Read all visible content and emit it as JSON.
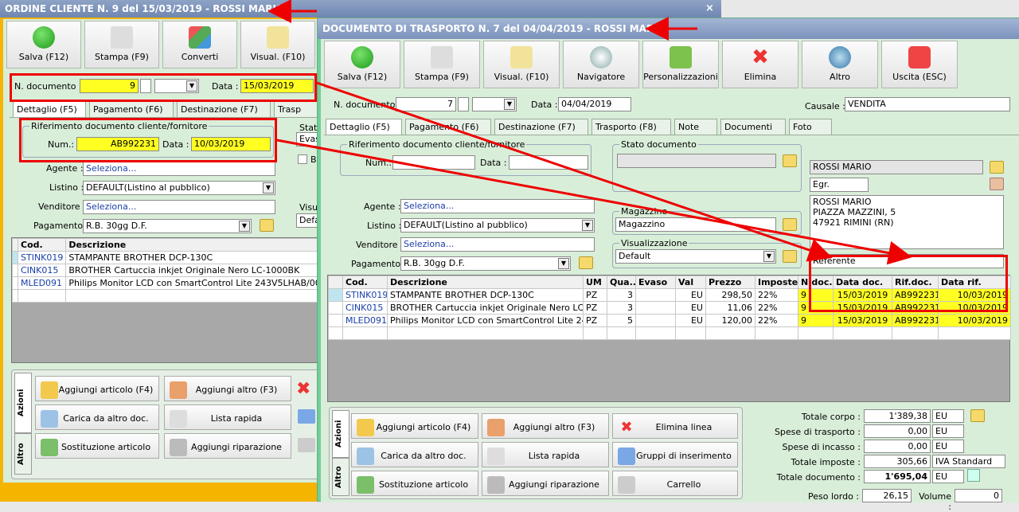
{
  "win1": {
    "title": "ORDINE CLIENTE N. 9 del 15/03/2019 - ROSSI MARIO",
    "close": "×",
    "toolbar": [
      "Salva (F12)",
      "Stampa (F9)",
      "Converti",
      "Visual. (F10)"
    ],
    "ndoc_label": "N. documento :",
    "ndoc_value": "9",
    "data_label": "Data :",
    "data_value": "15/03/2019",
    "tabs": [
      "Dettaglio (F5)",
      "Pagamento (F6)",
      "Destinazione (F7)",
      "Trasp"
    ],
    "rif_group": "Riferimento documento cliente/fornitore",
    "num_label": "Num.:",
    "num_value": "AB992231",
    "rif_data_label": "Data :",
    "rif_data_value": "10/03/2019",
    "stato_label": "Stato",
    "stato_value": "Evas",
    "bo_label": "Bo",
    "visual_label": "Visua",
    "visual_value": "Defa",
    "agente_label": "Agente :",
    "agente_value": "Seleziona...",
    "listino_label": "Listino :",
    "listino_value": "DEFAULT(Listino al pubblico)",
    "venditore_label": "Venditore :",
    "venditore_value": "Seleziona...",
    "pagamento_label": "Pagamento :",
    "pagamento_value": "R.B. 30gg D.F.",
    "grid_headers": [
      "Cod.",
      "Descrizione"
    ],
    "rows": [
      {
        "cod": "STINK019",
        "desc": "STAMPANTE BROTHER DCP-130C"
      },
      {
        "cod": "CINK015",
        "desc": "BROTHER Cartuccia inkjet Originale Nero LC-1000BK"
      },
      {
        "cod": "MLED091",
        "desc": "Philips Monitor LCD con SmartControl Lite 243V5LHAB/00"
      }
    ],
    "vtab_azioni": "Azioni",
    "vtab_altro": "Altro",
    "actions": [
      "Aggiungi articolo (F4)",
      "Aggiungi altro (F3)",
      "Carica da altro doc.",
      "Lista rapida",
      "Sostituzione articolo",
      "Aggiungi riparazione"
    ]
  },
  "win2": {
    "title": "DOCUMENTO DI TRASPORTO N. 7 del 04/04/2019 - ROSSI MARIO",
    "toolbar": [
      "Salva (F12)",
      "Stampa (F9)",
      "Visual. (F10)",
      "Navigatore",
      "Personalizzazioni",
      "Elimina",
      "Altro",
      "Uscita (ESC)"
    ],
    "ndoc_label": "N. documento :",
    "ndoc_value": "7",
    "data_label": "Data :",
    "data_value": "04/04/2019",
    "causale_label": "Causale :",
    "causale_value": "VENDITA",
    "tabs": [
      "Dettaglio (F5)",
      "Pagamento (F6)",
      "Destinazione (F7)",
      "Trasporto (F8)",
      "Note",
      "Documenti",
      "Foto"
    ],
    "rif_group": "Riferimento documento cliente/fornitore",
    "num_label": "Num.:",
    "rif_data_label": "Data :",
    "stato_group": "Stato documento",
    "magazzino_group": "Magazzino",
    "magazzino_value": "Magazzino",
    "visual_group": "Visualizzazione",
    "visual_value": "Default",
    "cliente_name": "ROSSI MARIO",
    "egr": "Egr.",
    "addr": [
      "ROSSI MARIO",
      "PIAZZA MAZZINI, 5",
      "47921 RIMINI (RN)"
    ],
    "referente_label": "Referente",
    "agente_label": "Agente :",
    "agente_value": "Seleziona...",
    "listino_label": "Listino :",
    "listino_value": "DEFAULT(Listino al pubblico)",
    "venditore_label": "Venditore :",
    "venditore_value": "Seleziona...",
    "pagamento_label": "Pagamento :",
    "pagamento_value": "R.B. 30gg D.F.",
    "grid_headers": [
      "Cod.",
      "Descrizione",
      "UM",
      "Qua...",
      "Evaso",
      "Val",
      "Prezzo",
      "Imposte",
      "N.doc.",
      "Data doc.",
      "Rif.doc.",
      "Data rif."
    ],
    "rows": [
      {
        "cod": "STINK019",
        "desc": "STAMPANTE BROTHER DCP-130C",
        "um": "PZ",
        "qta": "3",
        "evaso": "",
        "val": "EU",
        "prezzo": "298,50",
        "imp": "22%",
        "ndoc": "9",
        "datadoc": "15/03/2019",
        "rifdoc": "AB992231",
        "datarif": "10/03/2019"
      },
      {
        "cod": "CINK015",
        "desc": "BROTHER Cartuccia inkjet Originale Nero LC-10...",
        "um": "PZ",
        "qta": "3",
        "evaso": "",
        "val": "EU",
        "prezzo": "11,06",
        "imp": "22%",
        "ndoc": "9",
        "datadoc": "15/03/2019",
        "rifdoc": "AB992231",
        "datarif": "10/03/2019"
      },
      {
        "cod": "MLED091",
        "desc": "Philips Monitor LCD con SmartControl Lite 243V...",
        "um": "PZ",
        "qta": "5",
        "evaso": "",
        "val": "EU",
        "prezzo": "120,00",
        "imp": "22%",
        "ndoc": "9",
        "datadoc": "15/03/2019",
        "rifdoc": "AB992231",
        "datarif": "10/03/2019"
      }
    ],
    "vtab_azioni": "Azioni",
    "vtab_altro": "Altro",
    "actions": [
      "Aggiungi articolo (F4)",
      "Aggiungi altro (F3)",
      "Elimina linea",
      "Carica da altro doc.",
      "Lista rapida",
      "Gruppi di inserimento",
      "Sostituzione articolo",
      "Aggiungi riparazione",
      "Carrello"
    ],
    "totals": {
      "corpo_label": "Totale corpo :",
      "corpo": "1'389,38",
      "corpo_cur": "EU",
      "trasp_label": "Spese di trasporto :",
      "trasp": "0,00",
      "trasp_cur": "EU",
      "incasso_label": "Spese di incasso :",
      "incasso": "0,00",
      "incasso_cur": "EU",
      "imposte_label": "Totale imposte :",
      "imposte": "305,66",
      "imposte_cur": "IVA Standard",
      "doc_label": "Totale documento :",
      "doc": "1'695,04",
      "doc_cur": "EU",
      "peso_label": "Peso lordo :",
      "peso": "26,15",
      "volume_label": "Volume :",
      "volume": "0"
    }
  }
}
